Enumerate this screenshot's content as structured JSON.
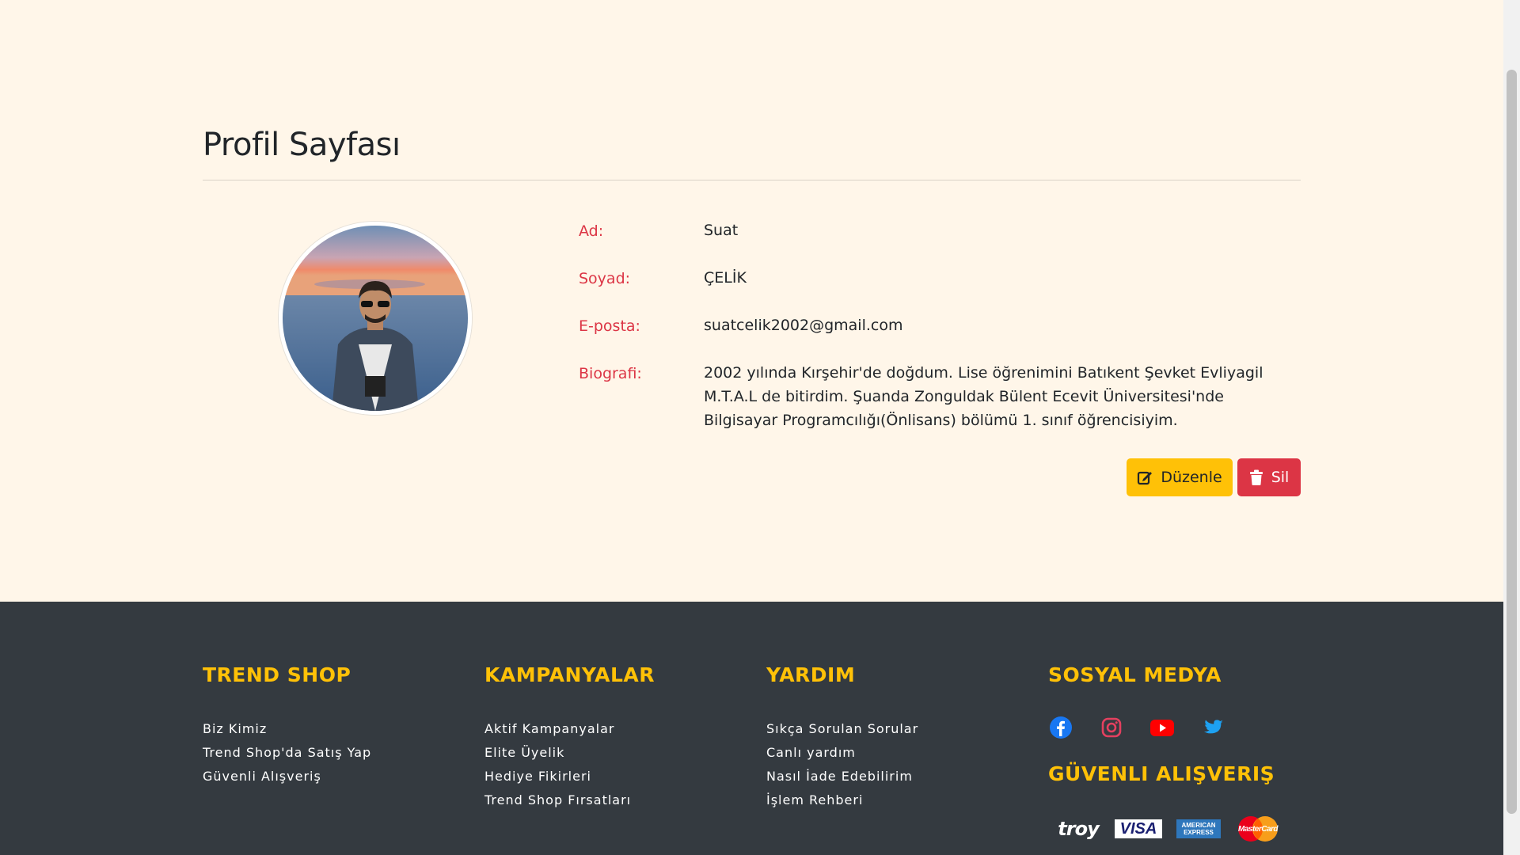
{
  "profile": {
    "title": "Profil Sayfası",
    "fields": [
      {
        "label": "Ad:",
        "value": "Suat"
      },
      {
        "label": "Soyad:",
        "value": "ÇELİK"
      },
      {
        "label": "E-posta:",
        "value": "suatcelik2002@gmail.com"
      },
      {
        "label": "Biografi:",
        "value": "2002 yılında Kırşehir'de doğdum. Lise öğrenimini Batıkent Şevket Evliyagil M.T.A.L de bitirdim. Şuanda Zonguldak Bülent Ecevit Üniversitesi'nde Bilgisayar Programcılığı(Önlisans) bölümü 1. sınıf öğrencisiyim."
      }
    ],
    "edit_label": "Düzenle",
    "delete_label": "Sil"
  },
  "footer": {
    "columns": [
      {
        "heading": "TREND SHOP",
        "links": [
          "Biz Kimiz",
          "Trend Shop'da Satış Yap",
          "Güvenli Alışveriş"
        ]
      },
      {
        "heading": "KAMPANYALAR",
        "links": [
          "Aktif Kampanyalar",
          "Elite Üyelik",
          "Hediye Fikirleri",
          "Trend Shop Fırsatları"
        ]
      },
      {
        "heading": "YARDIM",
        "links": [
          "Sıkça Sorulan Sorular",
          "Canlı yardım",
          "Nasıl İade Edebilirim",
          "İşlem Rehberi"
        ]
      }
    ],
    "social_heading": "SOSYAL MEDYA",
    "social_icons": [
      "facebook-icon",
      "instagram-icon",
      "youtube-icon",
      "twitter-icon"
    ],
    "secure_heading": "GÜVENLI ALIŞVERIŞ",
    "payment_logos": {
      "troy": "troy",
      "visa": "VISA",
      "amex_line1": "AMERICAN",
      "amex_line2": "EXPRESS",
      "mastercard": "MasterCard"
    }
  },
  "colors": {
    "background": "#fff6e9",
    "label_red": "#dc3545",
    "edit_yellow": "#ffc107",
    "delete_red": "#dc3545",
    "footer_bg": "#343a40",
    "footer_heading": "#ffc107"
  }
}
